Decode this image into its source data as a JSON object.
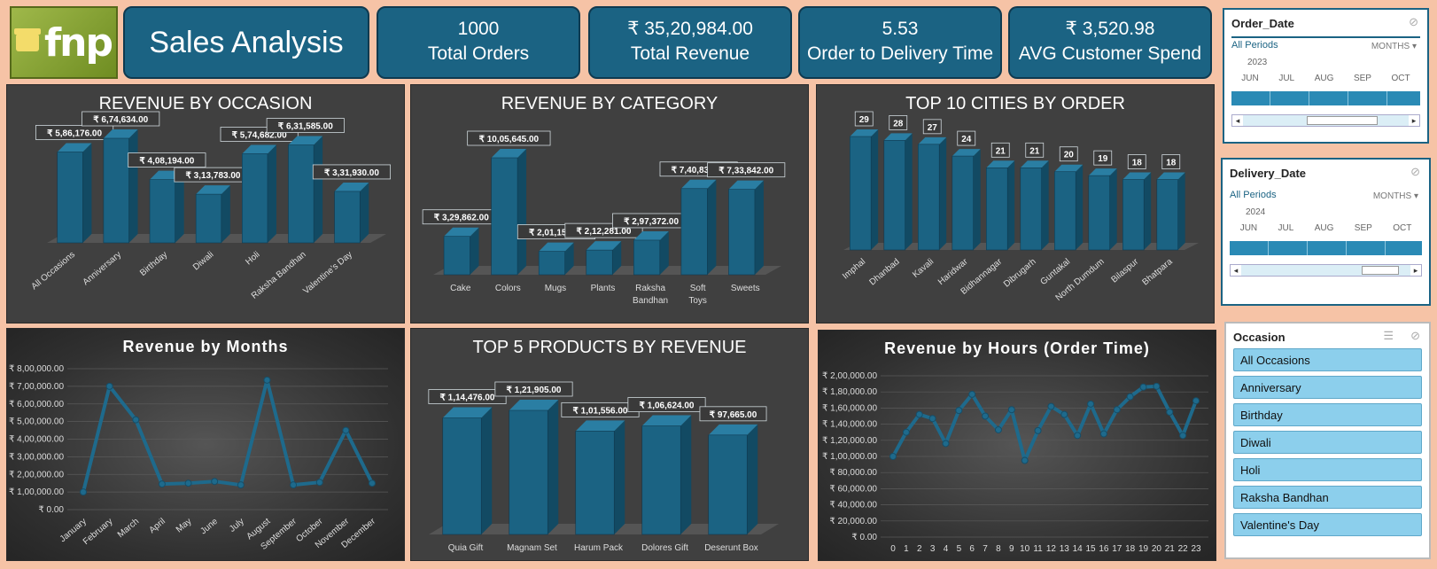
{
  "header": {
    "logo_text": "fnp",
    "title": "Sales Analysis",
    "kpis": [
      {
        "value": "1000",
        "label": "Total Orders"
      },
      {
        "value": "₹ 35,20,984.00",
        "label": "Total Revenue"
      },
      {
        "value": "5.53",
        "label": "Order to Delivery Time"
      },
      {
        "value": "₹ 3,520.98",
        "label": "AVG Customer Spend"
      }
    ]
  },
  "slicers": {
    "order_date": {
      "title": "Order_Date",
      "period": "All Periods",
      "unit": "MONTHS",
      "year": "2023",
      "months": [
        "JUN",
        "JUL",
        "AUG",
        "SEP",
        "OCT"
      ]
    },
    "delivery_date": {
      "title": "Delivery_Date",
      "period": "All Periods",
      "unit": "MONTHS",
      "year": "2024",
      "months": [
        "JUN",
        "JUL",
        "AUG",
        "SEP",
        "OCT"
      ]
    },
    "occasion": {
      "title": "Occasion",
      "items": [
        "All Occasions",
        "Anniversary",
        "Birthday",
        "Diwali",
        "Holi",
        "Raksha Bandhan",
        "Valentine's Day"
      ]
    }
  },
  "colors": {
    "bar": "#1b6383",
    "accent": "#1b6383",
    "slicer_item": "#8ccfec",
    "background": "#f6c3a6"
  },
  "chart_data": [
    {
      "type": "bar",
      "title": "REVENUE BY OCCASION",
      "categories": [
        "All Occasions",
        "Anniversary",
        "Birthday",
        "Diwali",
        "Holi",
        "Raksha Bandhan",
        "Valentine's Day"
      ],
      "values": [
        586176,
        674634,
        408194,
        313783,
        574682,
        631585,
        331930
      ],
      "labels": [
        "₹ 5,86,176.00",
        "₹ 6,74,634.00",
        "₹ 4,08,194.00",
        "₹ 3,13,783.00",
        "₹ 5,74,682.00",
        "₹ 6,31,585.00",
        "₹ 3,31,930.00"
      ]
    },
    {
      "type": "bar",
      "title": "REVENUE BY CATEGORY",
      "categories": [
        "Cake",
        "Colors",
        "Mugs",
        "Plants",
        "Raksha Bandhan",
        "Soft Toys",
        "Sweets"
      ],
      "values": [
        329862,
        1005645,
        201151,
        212281,
        297372,
        740831,
        733842
      ],
      "labels": [
        "₹ 3,29,862.00",
        "₹ 10,05,645.00",
        "₹ 2,01,151.00",
        "₹ 2,12,281.00",
        "₹ 2,97,372.00",
        "₹ 7,40,831.00",
        "₹ 7,33,842.00"
      ]
    },
    {
      "type": "bar",
      "title": "TOP 10 CITIES BY ORDER",
      "categories": [
        "Imphal",
        "Dhanbad",
        "Kavali",
        "Haridwar",
        "Bidhannagar",
        "Dibrugarh",
        "Guntakal",
        "North Dumdum",
        "Bilaspur",
        "Bhatpara"
      ],
      "values": [
        29,
        28,
        27,
        24,
        21,
        21,
        20,
        19,
        18,
        18
      ]
    },
    {
      "type": "line",
      "title": "Revenue by Months",
      "categories": [
        "January",
        "February",
        "March",
        "April",
        "May",
        "June",
        "July",
        "August",
        "September",
        "October",
        "November",
        "December"
      ],
      "values": [
        100000,
        700000,
        510000,
        145000,
        150000,
        160000,
        140000,
        735000,
        140000,
        155000,
        450000,
        150000
      ],
      "yticks": [
        "₹ 0.00",
        "₹ 1,00,000.00",
        "₹ 2,00,000.00",
        "₹ 3,00,000.00",
        "₹ 4,00,000.00",
        "₹ 5,00,000.00",
        "₹ 6,00,000.00",
        "₹ 7,00,000.00",
        "₹ 8,00,000.00"
      ],
      "ylim": [
        0,
        800000
      ]
    },
    {
      "type": "bar",
      "title": "TOP 5 PRODUCTS BY REVENUE",
      "categories": [
        "Quia Gift",
        "Magnam Set",
        "Harum Pack",
        "Dolores Gift",
        "Deserunt Box"
      ],
      "values": [
        114476,
        121905,
        101556,
        106624,
        97665
      ],
      "labels": [
        "₹ 1,14,476.00",
        "₹ 1,21,905.00",
        "₹ 1,01,556.00",
        "₹ 1,06,624.00",
        "₹ 97,665.00"
      ]
    },
    {
      "type": "line",
      "title": "Revenue by Hours (Order Time)",
      "categories": [
        "0",
        "1",
        "2",
        "3",
        "4",
        "5",
        "6",
        "7",
        "8",
        "9",
        "10",
        "11",
        "12",
        "13",
        "14",
        "15",
        "16",
        "17",
        "18",
        "19",
        "20",
        "21",
        "22",
        "23"
      ],
      "values": [
        100000,
        130000,
        152000,
        147000,
        116000,
        157000,
        177000,
        150000,
        133000,
        158000,
        95000,
        132000,
        162000,
        152000,
        126000,
        165000,
        128000,
        158000,
        174000,
        186000,
        187000,
        155000,
        126000,
        169000
      ],
      "yticks": [
        "₹ 0.00",
        "₹ 20,000.00",
        "₹ 40,000.00",
        "₹ 60,000.00",
        "₹ 80,000.00",
        "₹ 1,00,000.00",
        "₹ 1,20,000.00",
        "₹ 1,40,000.00",
        "₹ 1,60,000.00",
        "₹ 1,80,000.00",
        "₹ 2,00,000.00"
      ],
      "ylim": [
        0,
        200000
      ]
    }
  ]
}
